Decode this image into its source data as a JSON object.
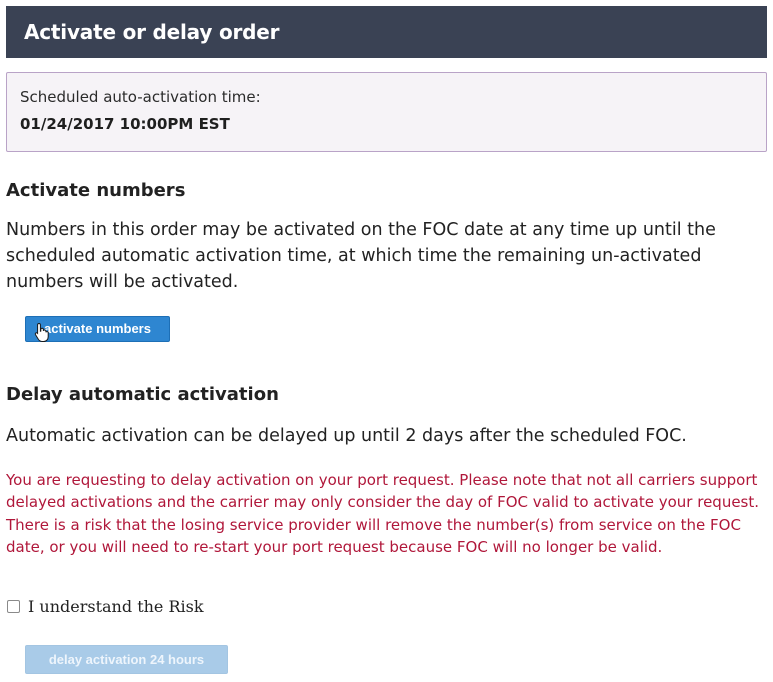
{
  "header": {
    "title": "Activate or delay order"
  },
  "schedule": {
    "label": "Scheduled auto-activation time:",
    "value": "01/24/2017 10:00PM EST"
  },
  "activate": {
    "heading": "Activate numbers",
    "description": "Numbers in this order may be activated on the FOC date at any time up until the scheduled automatic activation time, at which time the remaining un-activated numbers will be activated.",
    "button_label": "activate numbers"
  },
  "delay": {
    "heading": "Delay automatic activation",
    "description": "Automatic activation can be delayed up until 2 days after the scheduled FOC.",
    "warning": "You are requesting to delay activation on your port request. Please note that not all carriers support delayed activations and the carrier may only consider the day of FOC valid to activate your request. There is a risk that the losing service provider will remove the number(s) from service on the FOC date, or you will need to re-start your port request because FOC will no longer be valid.",
    "checkbox_label": "I understand the Risk",
    "checkbox_checked": false,
    "button_label": "delay activation 24 hours",
    "button_enabled": false
  },
  "colors": {
    "header_bg": "#3a4254",
    "primary_button": "#2e86d1",
    "disabled_button": "#a9cbe8",
    "warning_text": "#b0173a",
    "schedule_border": "#b9a3c7"
  },
  "icons": {
    "cursor": "hand-pointer-icon"
  }
}
